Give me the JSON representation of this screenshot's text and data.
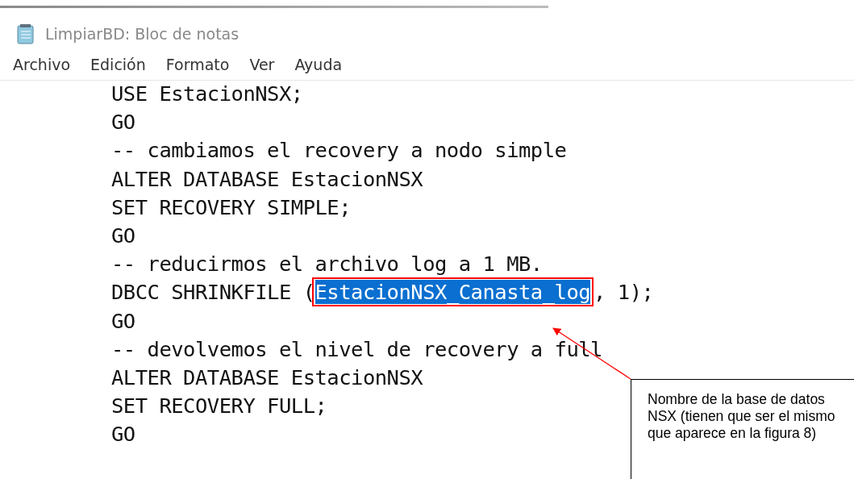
{
  "window": {
    "title": "LimpiarBD: Bloc de notas"
  },
  "menu": [
    "Archivo",
    "Edición",
    "Formato",
    "Ver",
    "Ayuda"
  ],
  "editor": {
    "lines": [
      {
        "text": "USE EstacionNSX;"
      },
      {
        "text": "GO"
      },
      {
        "text": "-- cambiamos el recovery a nodo simple"
      },
      {
        "text": "ALTER DATABASE EstacionNSX"
      },
      {
        "text": "SET RECOVERY SIMPLE;"
      },
      {
        "text": "GO"
      },
      {
        "text": "-- reducirmos el archivo log a 1 MB."
      },
      {
        "segments": [
          {
            "text": "DBCC SHRINKFILE (",
            "selected": false
          },
          {
            "text": "EstacionNSX_Canasta_log",
            "selected": true
          },
          {
            "text": ", 1);",
            "selected": false
          }
        ]
      },
      {
        "text": "GO"
      },
      {
        "text": "-- devolvemos el nivel de recovery a full"
      },
      {
        "text": "ALTER DATABASE EstacionNSX"
      },
      {
        "text": "SET RECOVERY FULL;"
      },
      {
        "text": "GO"
      }
    ]
  },
  "callout": {
    "text": "Nombre de la base de datos NSX (tienen que ser el mismo que aparece en la figura 8)"
  }
}
